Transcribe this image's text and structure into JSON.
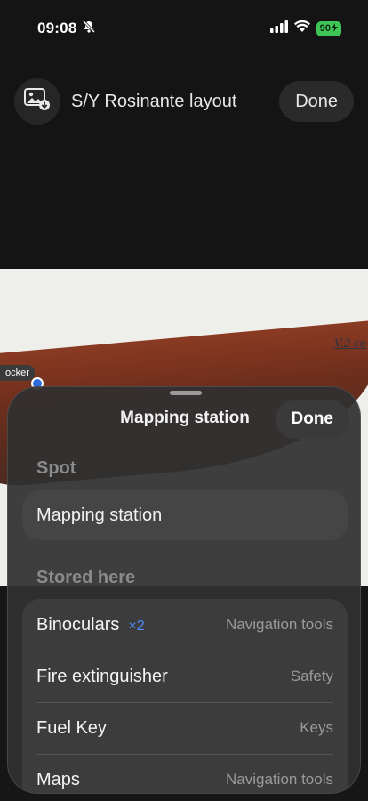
{
  "status": {
    "time": "09:08",
    "battery": "90"
  },
  "header": {
    "title": "S/Y Rosinante layout",
    "done_label": "Done"
  },
  "plan": {
    "label": "V.2 co",
    "marker_label": "ocker"
  },
  "sheet": {
    "title": "Mapping station",
    "done_label": "Done",
    "spot_section": "Spot",
    "spot_value": "Mapping station",
    "stored_section": "Stored here",
    "items": [
      {
        "name": "Binoculars",
        "qty": "×2",
        "category": "Navigation tools"
      },
      {
        "name": "Fire extinguisher",
        "qty": "",
        "category": "Safety"
      },
      {
        "name": "Fuel Key",
        "qty": "",
        "category": "Keys"
      },
      {
        "name": "Maps",
        "qty": "",
        "category": "Navigation tools"
      }
    ]
  },
  "colors": {
    "accent": "#4c8dff",
    "battery": "#3fc456"
  }
}
